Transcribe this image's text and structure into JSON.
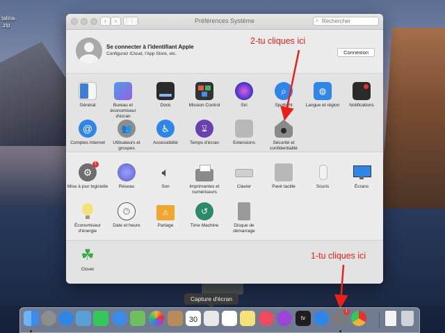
{
  "desktop": {
    "file_label_line1": "talina-",
    "file_label_line2": ".zip"
  },
  "window": {
    "title": "Préférences Système",
    "search_placeholder": "Rechercher",
    "back_icon": "chevron-left-icon",
    "forward_icon": "chevron-right-icon",
    "grid_icon": "grid-icon"
  },
  "account": {
    "title": "Se connecter à l'identifiant Apple",
    "subtitle": "Configurez iCloud, l'App Store, etc.",
    "button": "Connexion"
  },
  "section1": [
    {
      "label": "Général",
      "color": "#3d7fd8"
    },
    {
      "label": "Bureau et économiseur d'écran",
      "color": "#4b9be8"
    },
    {
      "label": "Dock",
      "color": "#2b2b2b"
    },
    {
      "label": "Mission Control",
      "color": "#333333"
    },
    {
      "label": "Siri",
      "color": "#5b3fd6"
    },
    {
      "label": "Spotlight",
      "color": "#2f86e6"
    },
    {
      "label": "Langue et région",
      "color": "#2f86e6"
    },
    {
      "label": "Notifications",
      "color": "#2a2a2a"
    },
    {
      "label": "Comptes Internet",
      "color": "#2f86e6"
    },
    {
      "label": "Utilisateurs et groupes",
      "color": "#8d8d8d"
    },
    {
      "label": "Accessibilité",
      "color": "#2f86e6"
    },
    {
      "label": "Temps d'écran",
      "color": "#6a3fb0"
    },
    {
      "label": "Extensions",
      "color": "#b8b8b8"
    },
    {
      "label": "Sécurité et confidentialité",
      "color": "#8a8a8a"
    }
  ],
  "section2": [
    {
      "label": "Mise à jour logicielle",
      "color": "#6e6e6e",
      "badge": "1"
    },
    {
      "label": "Réseau",
      "color": "#5b5fc7"
    },
    {
      "label": "Son",
      "color": "#4a4a4a"
    },
    {
      "label": "Imprimantes et numériseurs",
      "color": "#8a8a8a"
    },
    {
      "label": "Clavier",
      "color": "#cfcfcf"
    },
    {
      "label": "Pavé tactile",
      "color": "#b8b8b8"
    },
    {
      "label": "Souris",
      "color": "#f2f2f2"
    },
    {
      "label": "Écrans",
      "color": "#2f86e6"
    },
    {
      "label": "Économiseur d'énergie",
      "color": "#f2e27a"
    },
    {
      "label": "Date et heure",
      "color": "#f4f4f4"
    },
    {
      "label": "Partage",
      "color": "#f1a62f"
    },
    {
      "label": "Time Machine",
      "color": "#2b8a6a"
    },
    {
      "label": "Disque de démarrage",
      "color": "#9a9a9a"
    }
  ],
  "section3": [
    {
      "label": "Clover",
      "color": "#3aa845"
    }
  ],
  "annotations": {
    "top": "2-tu cliques ici",
    "bottom": "1-tu cliques ici",
    "color": "#e8201a"
  },
  "tooltip": "Capture d'écran",
  "dock": {
    "items": [
      {
        "name": "finder",
        "color": "#3d8be8"
      },
      {
        "name": "launchpad",
        "color": "#8e8e8e"
      },
      {
        "name": "safari",
        "color": "#2f86e6"
      },
      {
        "name": "preview",
        "color": "#5aa0d8"
      },
      {
        "name": "facetime",
        "color": "#35c759"
      },
      {
        "name": "messages",
        "color": "#3d8be8"
      },
      {
        "name": "maps",
        "color": "#6fbf5f"
      },
      {
        "name": "photos",
        "color": "#f2b13a"
      },
      {
        "name": "contacts",
        "color": "#b88b58"
      },
      {
        "name": "calendar",
        "color": "#ffffff",
        "text": "30"
      },
      {
        "name": "photo-booth",
        "color": "#e9e9e9"
      },
      {
        "name": "reminders",
        "color": "#ffffff"
      },
      {
        "name": "notes",
        "color": "#f5e07a"
      },
      {
        "name": "music",
        "color": "#f04a5f"
      },
      {
        "name": "podcasts",
        "color": "#9b45d8"
      },
      {
        "name": "tv",
        "color": "#1e1e1e",
        "text": "tv"
      },
      {
        "name": "app-store",
        "color": "#2f86e6"
      },
      {
        "name": "system-preferences",
        "color": "#7a7a7a",
        "badge": "1"
      },
      {
        "name": "chrome",
        "color": "#e9e9e9"
      },
      {
        "name": "document",
        "color": "#f4f4f4"
      },
      {
        "name": "trash",
        "color": "#cfd3d8"
      }
    ]
  }
}
